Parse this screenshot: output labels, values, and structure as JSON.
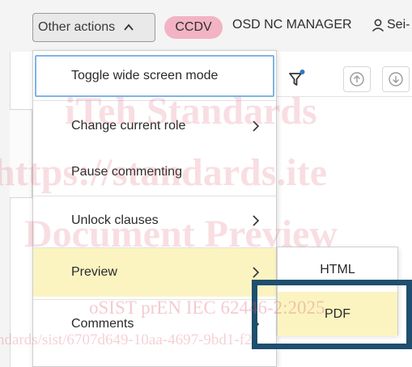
{
  "header": {
    "other_actions_label": "Other actions",
    "stage_badge": "CCDV",
    "role_label": "OSD NC MANAGER",
    "user_label": "Sei-"
  },
  "menu": {
    "items": [
      {
        "label": "Toggle wide screen mode",
        "has_submenu": false
      },
      {
        "label": "Change current role",
        "has_submenu": true
      },
      {
        "label": "Pause commenting",
        "has_submenu": false
      },
      {
        "label": "Unlock clauses",
        "has_submenu": true
      },
      {
        "label": "Preview",
        "has_submenu": true
      },
      {
        "label": "Comments",
        "has_submenu": true
      }
    ]
  },
  "submenu": {
    "items": [
      {
        "label": "HTML"
      },
      {
        "label": "PDF"
      }
    ]
  },
  "watermark": {
    "line1": "iTeh Standards",
    "line2": "https://standards.ite",
    "line3": "Document Preview",
    "line4": "oSIST prEN IEC 62446-2:2025",
    "line5": "ndards/sist/6707d649-10aa-4697-9bd1-f2"
  },
  "colors": {
    "badge": "#f2b3c5",
    "highlight": "#fbf4c1",
    "focus": "#7fb3e6",
    "pdf_frame": "#1e4f6e"
  }
}
